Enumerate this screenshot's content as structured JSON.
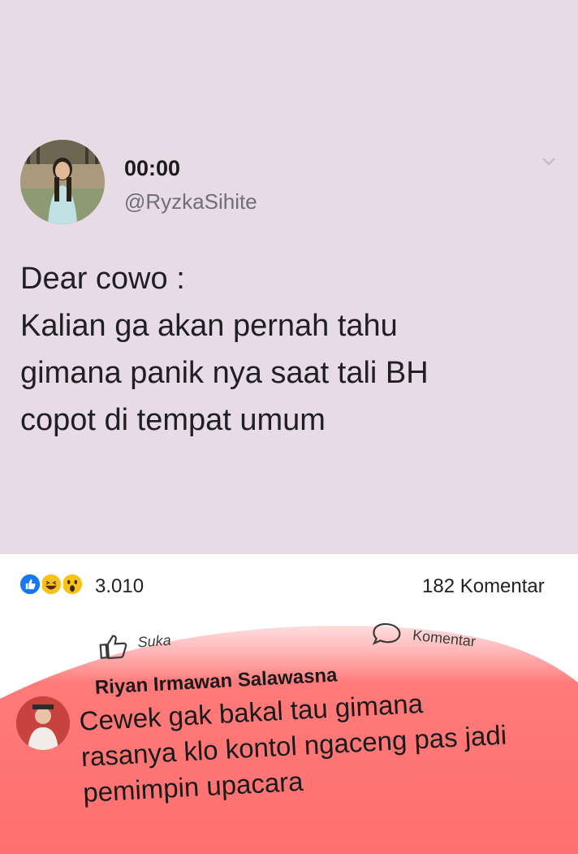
{
  "tweet": {
    "time": "00:00",
    "handle": "@RyzkaSihite",
    "lines": [
      "Dear cowo :",
      "Kalian ga akan pernah tahu",
      "gimana panik nya saat tali BH",
      "copot di tempat umum"
    ],
    "background": "#e7dce6"
  },
  "post": {
    "reaction_icons": [
      "like-reaction-icon",
      "haha-reaction-icon",
      "wow-reaction-icon"
    ],
    "reaction_count": "3.010",
    "comment_count": "182 Komentar",
    "like_label": "Suka",
    "comment_label": "Komentar"
  },
  "comment": {
    "author": "Riyan Irmawan Salawasna",
    "lines": [
      "Cewek gak bakal tau gimana",
      "rasanya klo kontol ngaceng pas jadi",
      "pemimpin upacara"
    ],
    "highlight_color": "#ff6f6f"
  }
}
